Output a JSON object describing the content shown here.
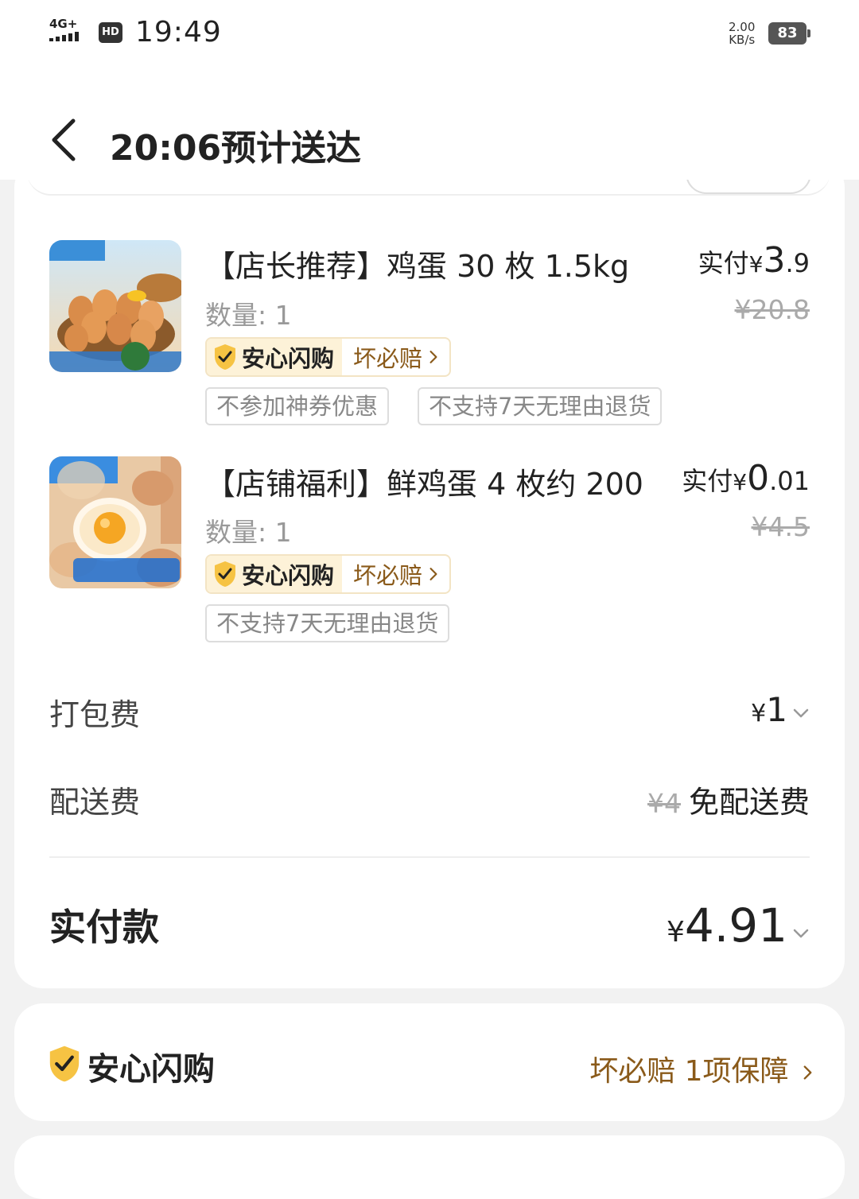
{
  "status": {
    "network": "4G+",
    "hd": "HD",
    "time": "19:49",
    "speed_value": "2.00",
    "speed_unit": "KB/s",
    "battery": "83"
  },
  "header": {
    "title": "20:06预计送达"
  },
  "items": [
    {
      "name": "【店长推荐】鸡蛋 30 枚 1.5kg",
      "qty": "数量: 1",
      "paid_label": "实付",
      "currency": "¥",
      "price_int": "3",
      "price_dec": ".9",
      "original_price": "¥20.8",
      "guard_brand": "安心闪购",
      "guard_promise": "坏必赔",
      "tags": [
        "不参加神券优惠",
        "不支持7天无理由退货"
      ]
    },
    {
      "name": "【店铺福利】鲜鸡蛋 4 枚约 200",
      "qty": "数量: 1",
      "paid_label": "实付",
      "currency": "¥",
      "price_int": "0",
      "price_dec": ".01",
      "original_price": "¥4.5",
      "guard_brand": "安心闪购",
      "guard_promise": "坏必赔",
      "tags": [
        "不支持7天无理由退货"
      ]
    }
  ],
  "fees": {
    "packing_label": "打包费",
    "packing_currency": "¥",
    "packing_value": "1",
    "delivery_label": "配送费",
    "delivery_original": "¥4",
    "delivery_value": "免配送费"
  },
  "total": {
    "label": "实付款",
    "currency": "¥",
    "value": "4.91"
  },
  "guarantee": {
    "brand": "安心闪购",
    "summary": "坏必赔 1项保障"
  },
  "colors": {
    "accent_brown": "#8a5a1a",
    "guard_bg": "#fdf2d8",
    "shield_yellow": "#f6c343"
  }
}
